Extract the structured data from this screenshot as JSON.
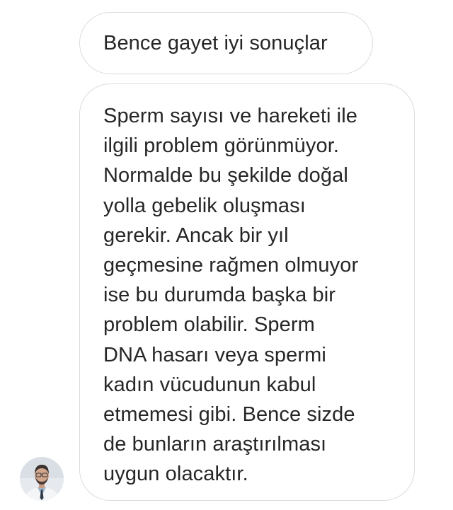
{
  "conversation": {
    "messages": [
      {
        "lines": [
          "Bence gayet iyi sonuçlar"
        ]
      },
      {
        "lines": [
          "Sperm sayısı ve hareketi ile",
          "ilgili problem görünmüyor.",
          "Normalde bu şekilde doğal",
          "yolla gebelik oluşması",
          "gerekir. Ancak bir yıl",
          "geçmesine rağmen olmuyor",
          "ise bu durumda başka bir",
          "problem olabilir. Sperm",
          "DNA hasarı veya spermi",
          "kadın vücudunun kabul",
          "etmemesi gibi. Bence sizde",
          "de bunların araştırılması",
          "uygun olacaktır."
        ]
      }
    ],
    "sender_avatar": {
      "icon": "avatar-photo-icon"
    }
  },
  "colors": {
    "bubble_border": "#dcdcdc",
    "bubble_background": "#ffffff",
    "text": "#262626"
  }
}
